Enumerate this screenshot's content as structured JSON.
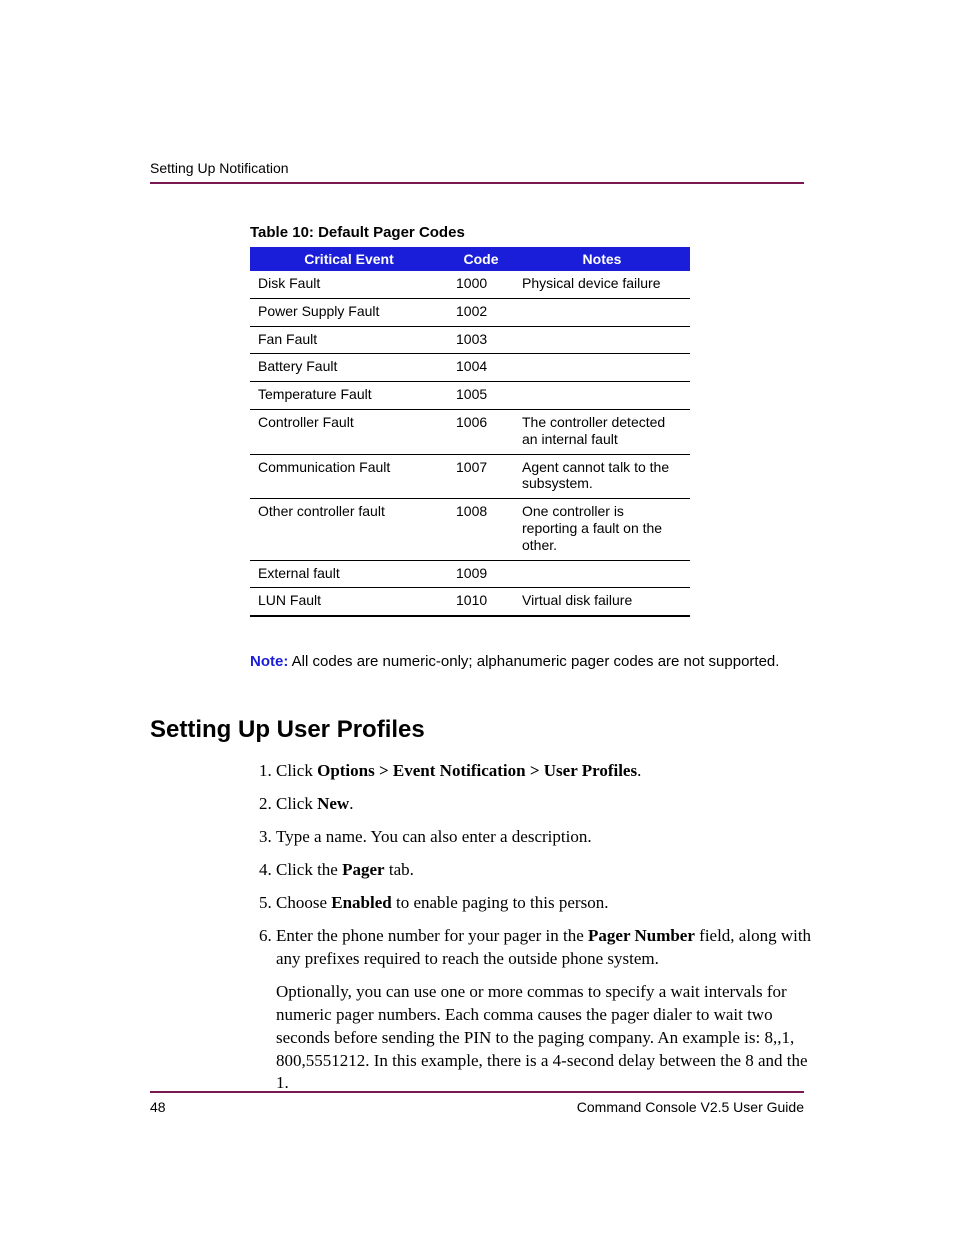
{
  "header": {
    "running": "Setting Up Notification"
  },
  "table": {
    "caption": "Table 10:  Default Pager Codes",
    "headers": {
      "event": "Critical Event",
      "code": "Code",
      "notes": "Notes"
    },
    "rows": [
      {
        "event": "Disk Fault",
        "code": "1000",
        "notes": "Physical device failure"
      },
      {
        "event": "Power Supply Fault",
        "code": "1002",
        "notes": ""
      },
      {
        "event": "Fan Fault",
        "code": "1003",
        "notes": ""
      },
      {
        "event": "Battery Fault",
        "code": "1004",
        "notes": ""
      },
      {
        "event": "Temperature Fault",
        "code": "1005",
        "notes": ""
      },
      {
        "event": "Controller Fault",
        "code": "1006",
        "notes": "The controller detected an internal fault"
      },
      {
        "event": "Communication Fault",
        "code": "1007",
        "notes": "Agent cannot talk to the subsystem."
      },
      {
        "event": "Other controller fault",
        "code": "1008",
        "notes": "One controller is reporting a fault on the other."
      },
      {
        "event": "External fault",
        "code": "1009",
        "notes": ""
      },
      {
        "event": "LUN Fault",
        "code": "1010",
        "notes": "Virtual disk failure"
      }
    ]
  },
  "note": {
    "label": "Note:",
    "text": "All codes are numeric-only; alphanumeric pager codes are not supported."
  },
  "section": {
    "title": "Setting Up User Profiles"
  },
  "steps": {
    "s1_a": "Click ",
    "s1_b": "Options > Event Notification > User Profiles",
    "s1_c": ".",
    "s2_a": "Click ",
    "s2_b": "New",
    "s2_c": ".",
    "s3": "Type a name. You can also enter a description.",
    "s4_a": "Click the ",
    "s4_b": "Pager",
    "s4_c": " tab.",
    "s5_a": "Choose ",
    "s5_b": "Enabled",
    "s5_c": " to enable paging to this person.",
    "s6_a": "Enter the phone number for your pager in the ",
    "s6_b": "Pager Number",
    "s6_c": " field, along with any prefixes required to reach the outside phone system.",
    "s6_p": "Optionally, you can use one or more commas to specify a wait intervals for numeric pager numbers. Each comma causes the pager dialer to wait two seconds before sending the PIN to the paging company. An example is: 8,,1, 800,5551212. In this example, there is a 4-second delay between the 8 and the 1."
  },
  "footer": {
    "page": "48",
    "title": "Command Console V2.5 User Guide"
  }
}
